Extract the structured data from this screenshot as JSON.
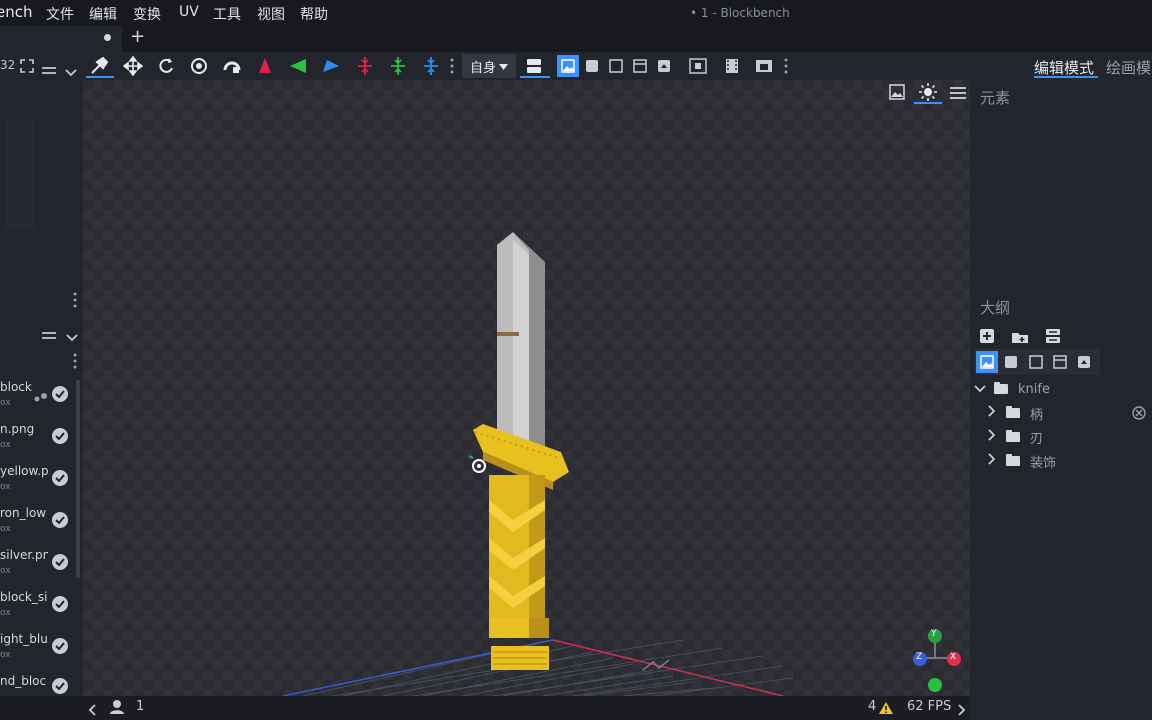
{
  "app": {
    "name_fragment": "ench",
    "window_title": "• 1 - Blockbench",
    "menu": [
      "文件",
      "编辑",
      "变换",
      "UV",
      "工具",
      "视图",
      "帮助"
    ]
  },
  "tab": {
    "new_tab_label": "+"
  },
  "toolbar": {
    "tools": [
      "move-icon",
      "resize-icon",
      "rotate-icon",
      "pivot-icon",
      "vertex-snap-icon",
      "mirror-x-icon",
      "mirror-y-icon",
      "mirror-z-icon",
      "center-x-icon",
      "center-y-icon",
      "center-z-icon"
    ],
    "transform_space": "自身",
    "view_modes": [
      "textured-icon",
      "solid-icon",
      "wireframe-icon",
      "uv-icon",
      "normal-icon"
    ]
  },
  "modes": {
    "edit": "编辑模式",
    "paint": "绘画模"
  },
  "left_panel": {
    "zoom_fragment": "32",
    "textures": [
      {
        "name": "block",
        "sub": "ox"
      },
      {
        "name": "n.png",
        "sub": "ox"
      },
      {
        "name": "yellow.p",
        "sub": "ox"
      },
      {
        "name": "ron_low",
        "sub": "ox"
      },
      {
        "name": "silver.pn",
        "sub": "ox"
      },
      {
        "name": "block_si",
        "sub": "ox"
      },
      {
        "name": "ight_blu",
        "sub": "ox"
      },
      {
        "name": "nd_bloc",
        "sub": "ox"
      }
    ]
  },
  "right_panel": {
    "elements_title": "元素",
    "outliner_title": "大纲",
    "tree": [
      {
        "label": "knife",
        "level": 0,
        "expanded": true
      },
      {
        "label": "柄",
        "level": 1,
        "expanded": false
      },
      {
        "label": "刃",
        "level": 1,
        "expanded": false
      },
      {
        "label": "装饰",
        "level": 1,
        "expanded": false
      }
    ]
  },
  "axis_gizmo": {
    "y": "Y",
    "z": "Z",
    "x": "X"
  },
  "status": {
    "count": "1",
    "warnings": "4",
    "fps": "62 FPS"
  },
  "colors": {
    "accent": "#3e90ff",
    "blade": "#b8b8b8",
    "handle": "#e8c020",
    "axis_x": "#e03050",
    "axis_y": "#30b050",
    "axis_z": "#3860d8"
  }
}
